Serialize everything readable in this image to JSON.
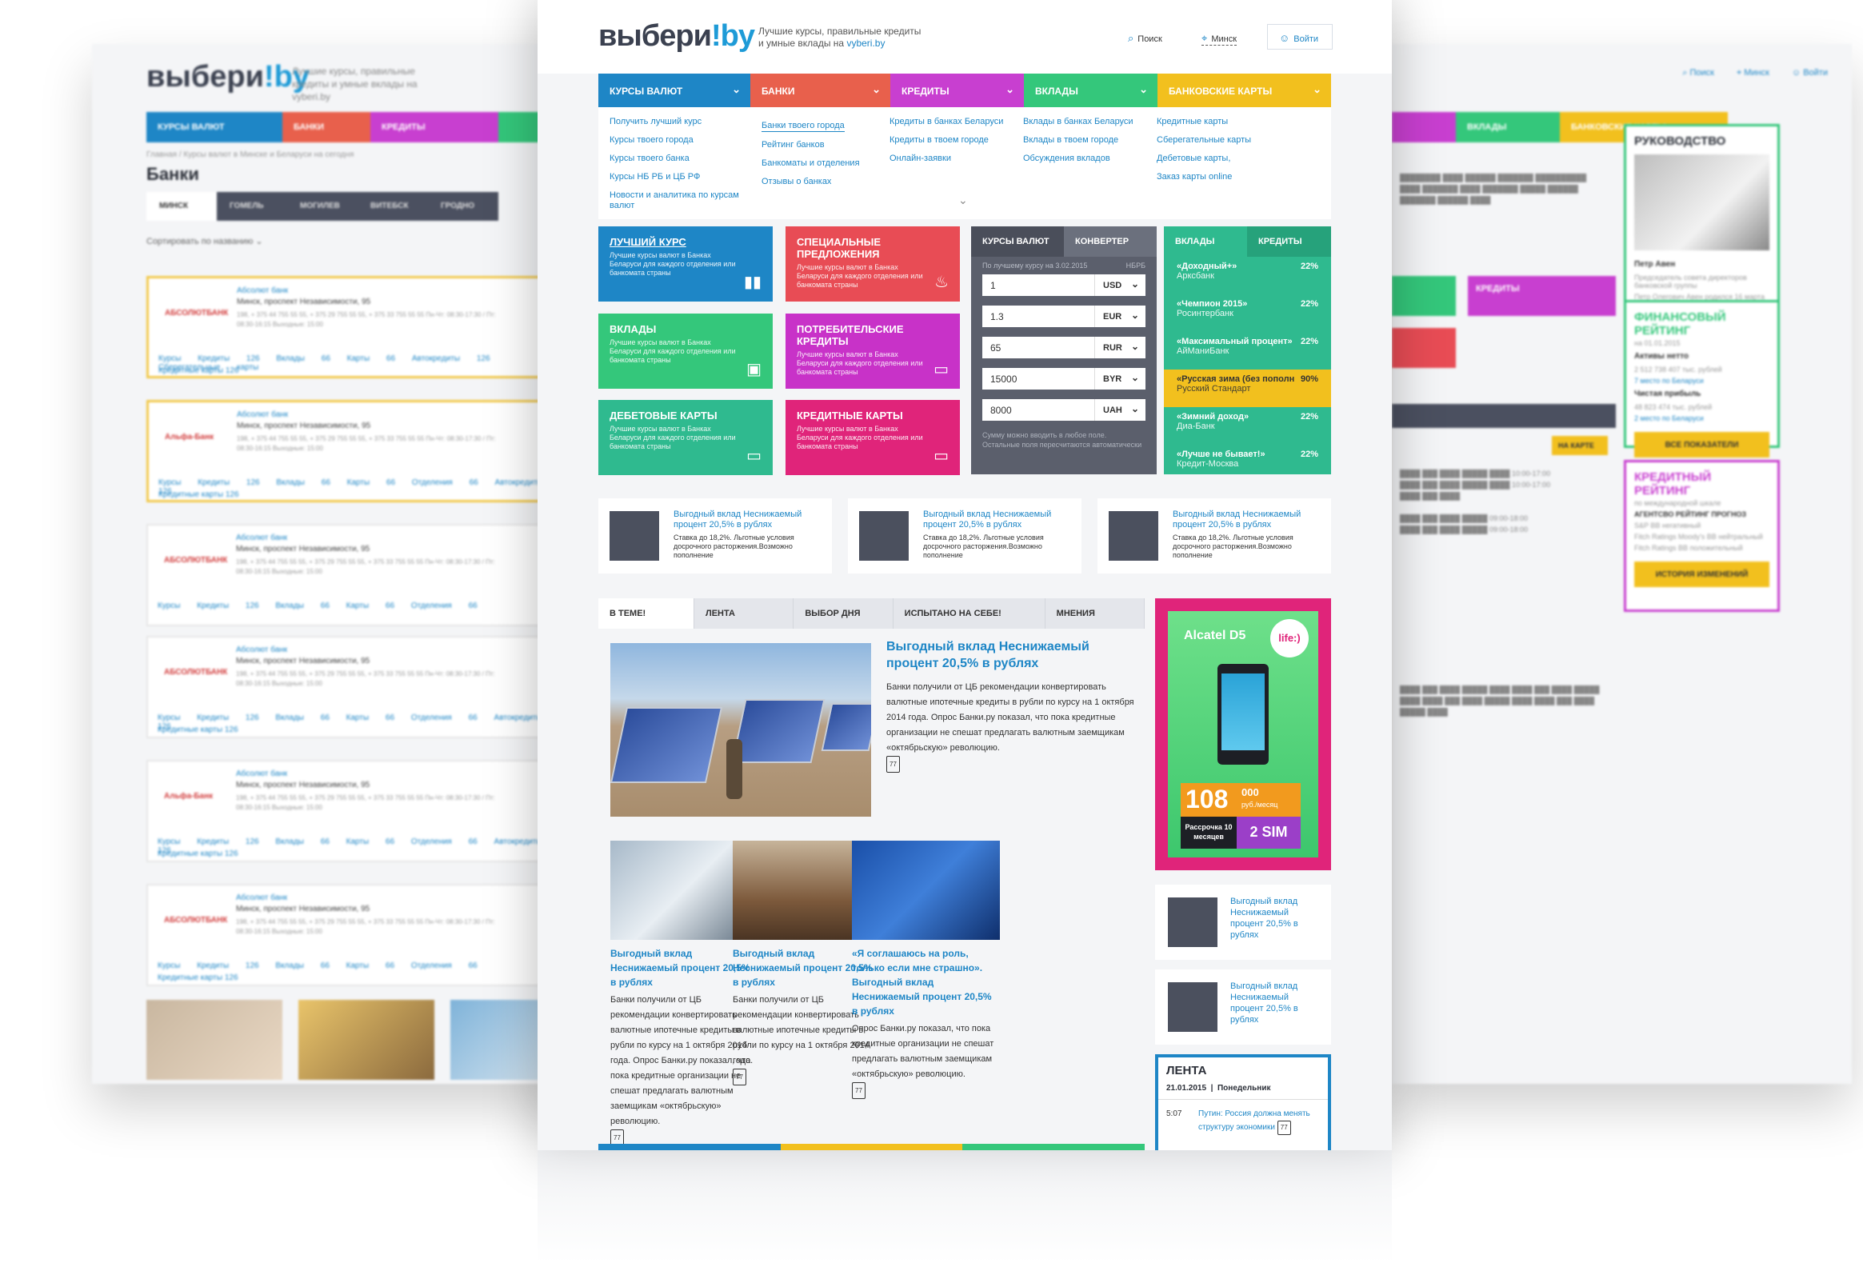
{
  "colors": {
    "blue": "#1e86c6",
    "orange": "#e8604c",
    "purple": "#c83fd0",
    "green": "#34c77b",
    "yellow": "#f2c01e",
    "teal": "#2fba8f",
    "pink": "#e0247a",
    "magenta": "#c832c8",
    "red": "#e84c55"
  },
  "header": {
    "logo_main": "выбери",
    "logo_accent": "!by",
    "tagline_1": "Лучшие курсы, правильные кредиты",
    "tagline_2": "и умные вклады на",
    "tagline_link": "vyberi.by",
    "search_label": "Поиск",
    "city_label": "Минск",
    "login_label": "Войти"
  },
  "nav": [
    {
      "label": "КУРСЫ ВАЛЮТ"
    },
    {
      "label": "БАНКИ"
    },
    {
      "label": "КРЕДИТЫ"
    },
    {
      "label": "ВКЛАДЫ"
    },
    {
      "label": "БАНКОВСКИЕ КАРТЫ"
    }
  ],
  "menu": {
    "col1": [
      "Получить лучший курс",
      "Курсы твоего города",
      "Курсы твоего банка",
      "Курсы НБ РБ и ЦБ РФ",
      "Новости и аналитика по курсам валют"
    ],
    "col2": [
      "Банки твоего города",
      "Рейтинг банков",
      "Банкоматы и отделения",
      "Отзывы о банках"
    ],
    "col3": [
      "Кредиты в банках Беларуси",
      "Кредиты в твоем городе",
      "Онлайн-заявки"
    ],
    "col4": [
      "Вклады в банках Беларуси",
      "Вклады в твоем городе",
      "Обсуждения вкладов"
    ],
    "col5": [
      "Кредитные карты",
      "Сберегательные карты",
      "Дебетовые карты,",
      "Заказ карты online"
    ]
  },
  "tiles": [
    {
      "title": "ЛУЧШИЙ КУРС",
      "desc": "Лучшие курсы валют в Банках Беларуси для каждого отделения или банкомата страны",
      "icon": "bars-icon"
    },
    {
      "title": "СПЕЦИАЛЬНЫЕ ПРЕДЛОЖЕНИЯ",
      "desc": "Лучшие курсы валют в Банках Беларуси для каждого отделения или банкомата страны",
      "icon": "fire-icon"
    },
    {
      "title": "ВКЛАДЫ",
      "desc": "Лучшие курсы валют в Банках Беларуси для каждого отделения или банкомата страны",
      "icon": "briefcase-icon"
    },
    {
      "title": "ПОТРЕБИТЕЛЬСКИЕ КРЕДИТЫ",
      "desc": "Лучшие курсы валют в Банках Беларуси для каждого отделения или банкомата страны",
      "icon": "monitor-icon"
    },
    {
      "title": "ДЕБЕТОВЫЕ КАРТЫ",
      "desc": "Лучшие курсы валют в Банках Беларуси для каждого отделения или банкомата страны",
      "icon": "card-icon"
    },
    {
      "title": "КРЕДИТНЫЕ КАРТЫ",
      "desc": "Лучшие курсы валют в Банках Беларуси для каждого отделения или банкомата страны",
      "icon": "card-icon"
    }
  ],
  "rates": {
    "tab1": "КУРСЫ ВАЛЮТ",
    "tab2": "КОНВЕРТЕР",
    "note_left": "По лучшему курсу на 3.02.2015",
    "note_right": "НБРБ",
    "rows": [
      {
        "value": "1",
        "currency": "USD"
      },
      {
        "value": "1.3",
        "currency": "EUR"
      },
      {
        "value": "65",
        "currency": "RUR"
      },
      {
        "value": "15000",
        "currency": "BYR"
      },
      {
        "value": "8000",
        "currency": "UAH"
      }
    ],
    "footer": "Сумму можно вводить в любое поле. Остальные поля пересчитаются автоматически"
  },
  "deposits": {
    "tab1": "ВКЛАДЫ",
    "tab2": "КРЕДИТЫ",
    "rows": [
      {
        "name": "«Доходный+»",
        "bank": "Арксбанк",
        "pct": "22%"
      },
      {
        "name": "«Чемпион 2015»",
        "bank": "Росинтербанк",
        "pct": "22%"
      },
      {
        "name": "«Максимальный процент»",
        "bank": "АйМаниБанк",
        "pct": "22%"
      },
      {
        "name": "«Русская зима (без пополн",
        "bank": "Русский Стандарт",
        "pct": "90%"
      },
      {
        "name": "«Зимний доход»",
        "bank": "Диа-Банк",
        "pct": "22%"
      },
      {
        "name": "«Лучше не бывает!»",
        "bank": "Кредит-Москва",
        "pct": "22%"
      }
    ]
  },
  "news_row": [
    {
      "title": "Выгодный вклад Неснижаемый процент 20,5% в рублях",
      "desc": "Ставка до 18,2%. Льготные условия досрочного расторжения.Возможно пополнение"
    },
    {
      "title": "Выгодный вклад Неснижаемый процент 20,5% в рублях",
      "desc": "Ставка до 18,2%. Льготные условия досрочного расторжения.Возможно пополнение"
    },
    {
      "title": "Выгодный вклад Неснижаемый процент 20,5% в рублях",
      "desc": "Ставка до 18,2%. Льготные условия досрочного расторжения.Возможно пополнение"
    }
  ],
  "feed_tabs": [
    "В ТЕМЕ!",
    "ЛЕНТА",
    "ВЫБОР ДНЯ",
    "ИСПЫТАНО НА СЕБЕ!",
    "МНЕНИЯ"
  ],
  "main_article": {
    "title": "Выгодный вклад Неснижаемый процент 20,5% в рублях",
    "text": "Банки получили от ЦБ рекомендации конвертировать валютные ипотечные кредиты в рубли по курсу на 1 октября 2014 года. Опрос Банки.ру показал, что пока кредитные организации не спешат предлагать валютным заемщикам «октябрьскую» революцию.",
    "comments": "77"
  },
  "small_articles": [
    {
      "title": "Выгодный вклад Неснижаемый процент 20,5% в рублях",
      "text": "Банки получили от ЦБ рекомендации конвертировать валютные ипотечные кредиты в рубли по курсу на 1 октября 2014 года. Опрос Банки.ру показал, что пока кредитные организации не спешат предлагать валютным заемщикам «октябрьскую» революцию.",
      "comments": "77"
    },
    {
      "title": "Выгодный вклад Неснижаемый процент 20,5% в рублях",
      "text": "Банки получили от ЦБ рекомендации конвертировать валютные ипотечные кредиты в рубли по курсу на 1 октября 2014 года.",
      "comments": "77"
    },
    {
      "title": "«Я соглашаюсь на роль, только если мне страшно». Выгодный вклад Неснижаемый процент 20,5% в рублях",
      "text": "Опрос Банки.ру показал, что пока кредитные организации не спешат предлагать валютным заемщикам «октябрьскую» революцию.",
      "comments": "77"
    }
  ],
  "ad": {
    "brand": "Alcatel D5",
    "operator": "life:)",
    "price": "108",
    "price_small": "000",
    "price_unit": "руб./месяц",
    "installment": "Рассрочка 10 месяцев",
    "sim": "2 SIM"
  },
  "side_news": [
    {
      "title": "Выгодный вклад Неснижаемый процент 20,5% в рублях"
    },
    {
      "title": "Выгодный вклад Неснижаемый процент 20,5% в рублях"
    }
  ],
  "lenta": {
    "title": "ЛЕНТА",
    "date": "21.01.2015",
    "weekday": "Понедельник",
    "item_time": "5:07",
    "item_text": "Путин: Россия должна менять структуру экономики",
    "item_comments": "77"
  },
  "left_page": {
    "logo_main": "выбери",
    "logo_accent": "!by",
    "tagline": "Лучшие курсы, правильные кредиты и умные вклады на vyberi.by",
    "nav": [
      "КУРСЫ ВАЛЮТ",
      "БАНКИ",
      "КРЕДИТЫ"
    ],
    "crumb": "Главная  /  Курсы валют в Минске и Беларуси на сегодня",
    "title": "Банки",
    "tabs": [
      "МИНСК",
      "ГОМЕЛЬ",
      "МОГИЛЕВ",
      "ВИТЕБСК",
      "ГРОДНО"
    ],
    "sort": "Сортировать по названию",
    "banks": [
      {
        "logo": "АБСОЛЮТБАНК",
        "name": "Абсолют банк",
        "address": "Минск, проспект Независимости, 95",
        "phones": "198, + 375 44 755 55 55, + 375 29 755 55 55, + 375 33 755 55 55 Пн-Чт: 08:30-17:30 / Пт: 08:30-16:15  Выходные: 15:00",
        "links": "Курсы Кредиты 126 Вклады 66 Карты 66 Автокредиты 126 Сберегательные карты",
        "links2": "Кредитные карты 126"
      },
      {
        "logo": "Альфа-Банк",
        "name": "Абсолют банк",
        "address": "Минск, проспект Независимости, 95",
        "phones": "198, + 375 44 755 55 55, + 375 29 755 55 55, + 375 33 755 55 55 Пн-Чт: 08:30-17:30 / Пт: 08:30-16:15  Выходные: 15:00",
        "links": "Курсы Кредиты 126 Вклады 66 Карты 66 Отделения 66 Автокредиты 126",
        "links2": "Кредитные карты 126"
      },
      {
        "logo": "АБСОЛЮТБАНК",
        "name": "Абсолют банк",
        "address": "Минск, проспект Независимости, 95",
        "phones": "198, + 375 44 755 55 55, + 375 29 755 55 55, + 375 33 755 55 55 Пн-Чт: 08:30-17:30 / Пт: 08:30-16:15  Выходные: 15:00",
        "links": "Курсы Кредиты 126 Вклады 66 Карты 66 Отделения 66",
        "links2": ""
      },
      {
        "logo": "АБСОЛЮТБАНК",
        "name": "Абсолют банк",
        "address": "Минск, проспект Независимости, 95",
        "phones": "198, + 375 44 755 55 55, + 375 29 755 55 55, + 375 33 755 55 55 Пн-Чт: 08:30-17:30 / Пт: 08:30-16:15  Выходные: 15:00",
        "links": "Курсы Кредиты 126 Вклады 66 Карты 66 Отделения 66 Автокредиты 126",
        "links2": "Кредитные карты 126"
      },
      {
        "logo": "Альфа-Банк",
        "name": "Абсолют банк",
        "address": "Минск, проспект Независимости, 95",
        "phones": "198, + 375 44 755 55 55, + 375 29 755 55 55, + 375 33 755 55 55 Пн-Чт: 08:30-17:30 / Пт: 08:30-16:15  Выходные: 15:00",
        "links": "Курсы Кредиты 126 Вклады 66 Карты 66 Отделения 66 Автокредиты 126",
        "links2": "Кредитные карты 126"
      },
      {
        "logo": "АБСОЛЮТБАНК",
        "name": "Абсолют банк",
        "address": "Минск, проспект Независимости, 95",
        "phones": "198, + 375 44 755 55 55, + 375 29 755 55 55, + 375 33 755 55 55 Пн-Чт: 08:30-17:30 / Пт: 08:30-16:15  Выходные: 15:00",
        "links": "Курсы Кредиты 126 Вклады 66 Карты 66 Отделения 66",
        "links2": "Кредитные карты 126"
      }
    ]
  },
  "right_page": {
    "search": "Поиск",
    "city": "Минск",
    "login": "Войти",
    "nav": [
      "ВКЛАДЫ",
      "БАНКОВСКИЕ КАРТЫ"
    ],
    "management_title": "РУКОВОДСТВО",
    "person_name": "Петр Авен",
    "person_role": "Председатель совета директоров банковской группы",
    "person_bio": "Петр Олегович Авен родился 16 марта 1955 года в Москве в семье преподавателей.",
    "fin_title": "ФИНАНСОВЫЙ РЕЙТИНГ",
    "fin_date": "на 01.01.2015",
    "assets_label": "Активы нетто",
    "assets_value": "2 512 738 407 тыс. рублей",
    "assets_rank": "7 место по Беларуси",
    "profit_label": "Чистая прибыль",
    "profit_value": "48 823 474 тыс. рублей",
    "profit_rank": "2 место по Беларуси",
    "all_button": "ВСЕ ПОКАЗАТЕЛИ",
    "credit_title": "КРЕДИТНЫЙ РЕЙТИНГ",
    "credit_sub": "по международной шкале",
    "credit_head": "АГЕНТСВО  РЕЙТИНГ  ПРОГНОЗ",
    "credit_rows": [
      "S&P  BB  негативный",
      "Fitch Ratings Moody's  BB  нейтральный",
      "Fitch Ratings  BB  положительный"
    ],
    "history_button": "ИСТОРИЯ ИЗМЕНЕНИЙ",
    "credits_tile": "КРЕДИТЫ",
    "map_button": "НА КАРТЕ"
  }
}
